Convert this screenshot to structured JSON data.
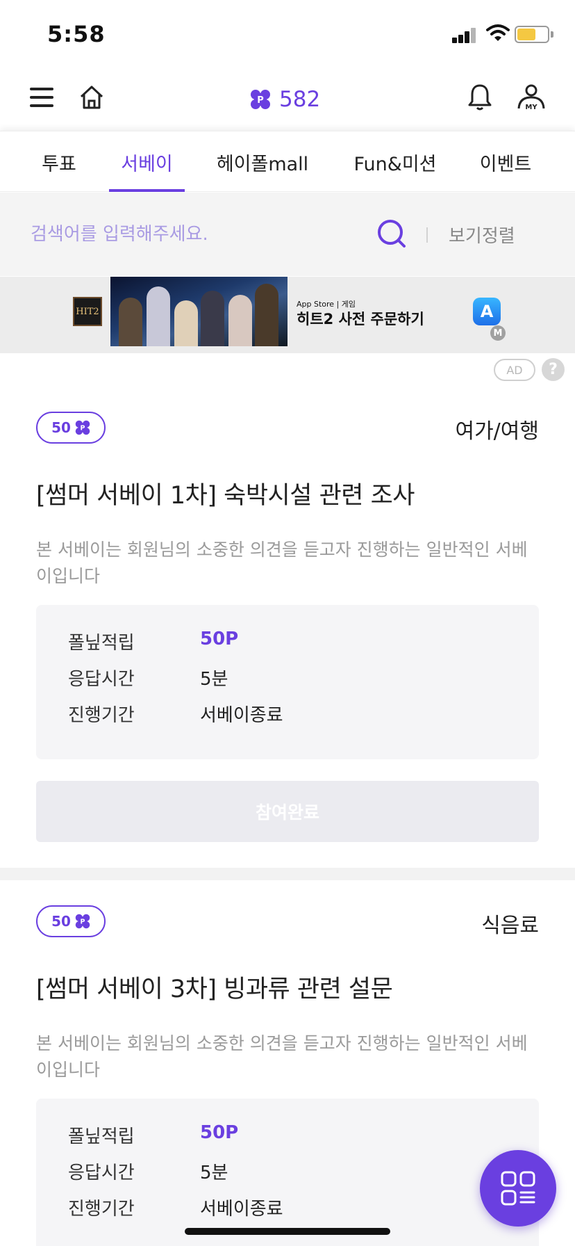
{
  "status_bar": {
    "time": "5:58"
  },
  "header": {
    "points": "582"
  },
  "tabs": [
    {
      "label": "투표"
    },
    {
      "label": "서베이"
    },
    {
      "label": "헤이폴mall"
    },
    {
      "label": "Fun&미션"
    },
    {
      "label": "이벤트"
    }
  ],
  "active_tab_index": 1,
  "search": {
    "placeholder": "검색어를 입력해주세요.",
    "value": "",
    "sort_label": "보기정렬"
  },
  "ad": {
    "logo_text": "HIT2",
    "store_label": "App Store | 게임",
    "title": "히트2 사전 주문하기",
    "m_badge": "M",
    "ad_tag": "AD",
    "help": "?"
  },
  "surveys": [
    {
      "points_badge": "50",
      "category": "여가/여행",
      "title": "[썸머 서베이 1차] 숙박시설 관련 조사",
      "description": "본 서베이는 회원님의 소중한 의견을 듣고자 진행하는 일반적인 서베이입니다",
      "info": [
        {
          "label": "폴닢적립",
          "value": "50P"
        },
        {
          "label": "응답시간",
          "value": "5분"
        },
        {
          "label": "진행기간",
          "value": "서베이종료"
        }
      ],
      "button_label": "참여완료"
    },
    {
      "points_badge": "50",
      "category": "식음료",
      "title": "[썸머 서베이 3차] 빙과류 관련 설문",
      "description": "본 서베이는 회원님의 소중한 의견을 듣고자 진행하는 일반적인 서베이입니다",
      "info": [
        {
          "label": "폴닢적립",
          "value": "50P"
        },
        {
          "label": "응답시간",
          "value": "5분"
        },
        {
          "label": "진행기간",
          "value": "서베이종료"
        }
      ]
    }
  ],
  "colors": {
    "accent": "#6a3fe0",
    "disabled_button": "#ebebf0",
    "info_box": "#f5f5f7",
    "battery": "#f4c842"
  },
  "icons": [
    "menu-icon",
    "home-icon",
    "point-coin-icon",
    "bell-icon",
    "my-profile-icon",
    "search-icon",
    "grid-menu-icon"
  ]
}
